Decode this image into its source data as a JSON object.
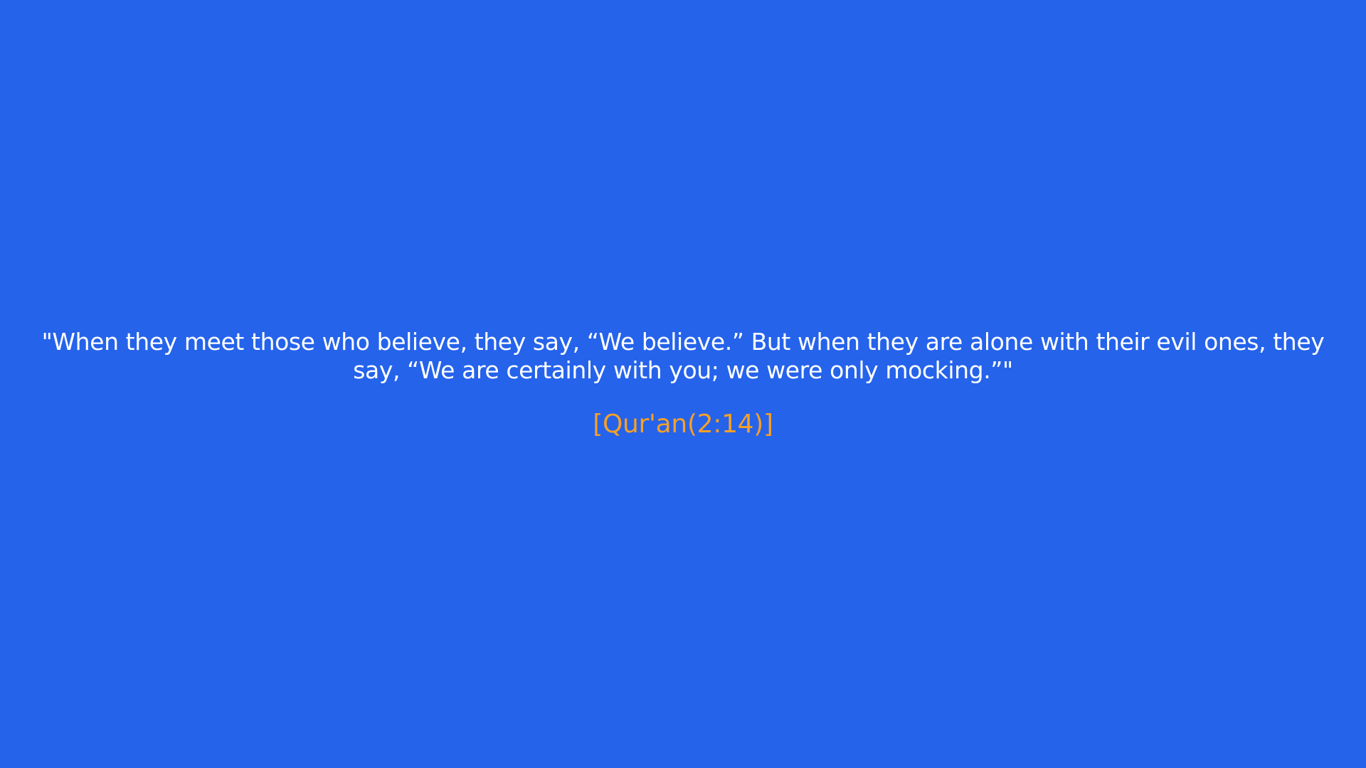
{
  "quote": {
    "text": "\"When they meet those who believe, they say, “We believe.” But when they are alone with their evil ones, they say, “We are certainly with you; we were only mocking.”\""
  },
  "reference": {
    "text": "[Qur'an(2:14)]"
  },
  "colors": {
    "background": "#2563eb",
    "quote_text": "#ffffff",
    "reference_text": "#f5a028"
  }
}
